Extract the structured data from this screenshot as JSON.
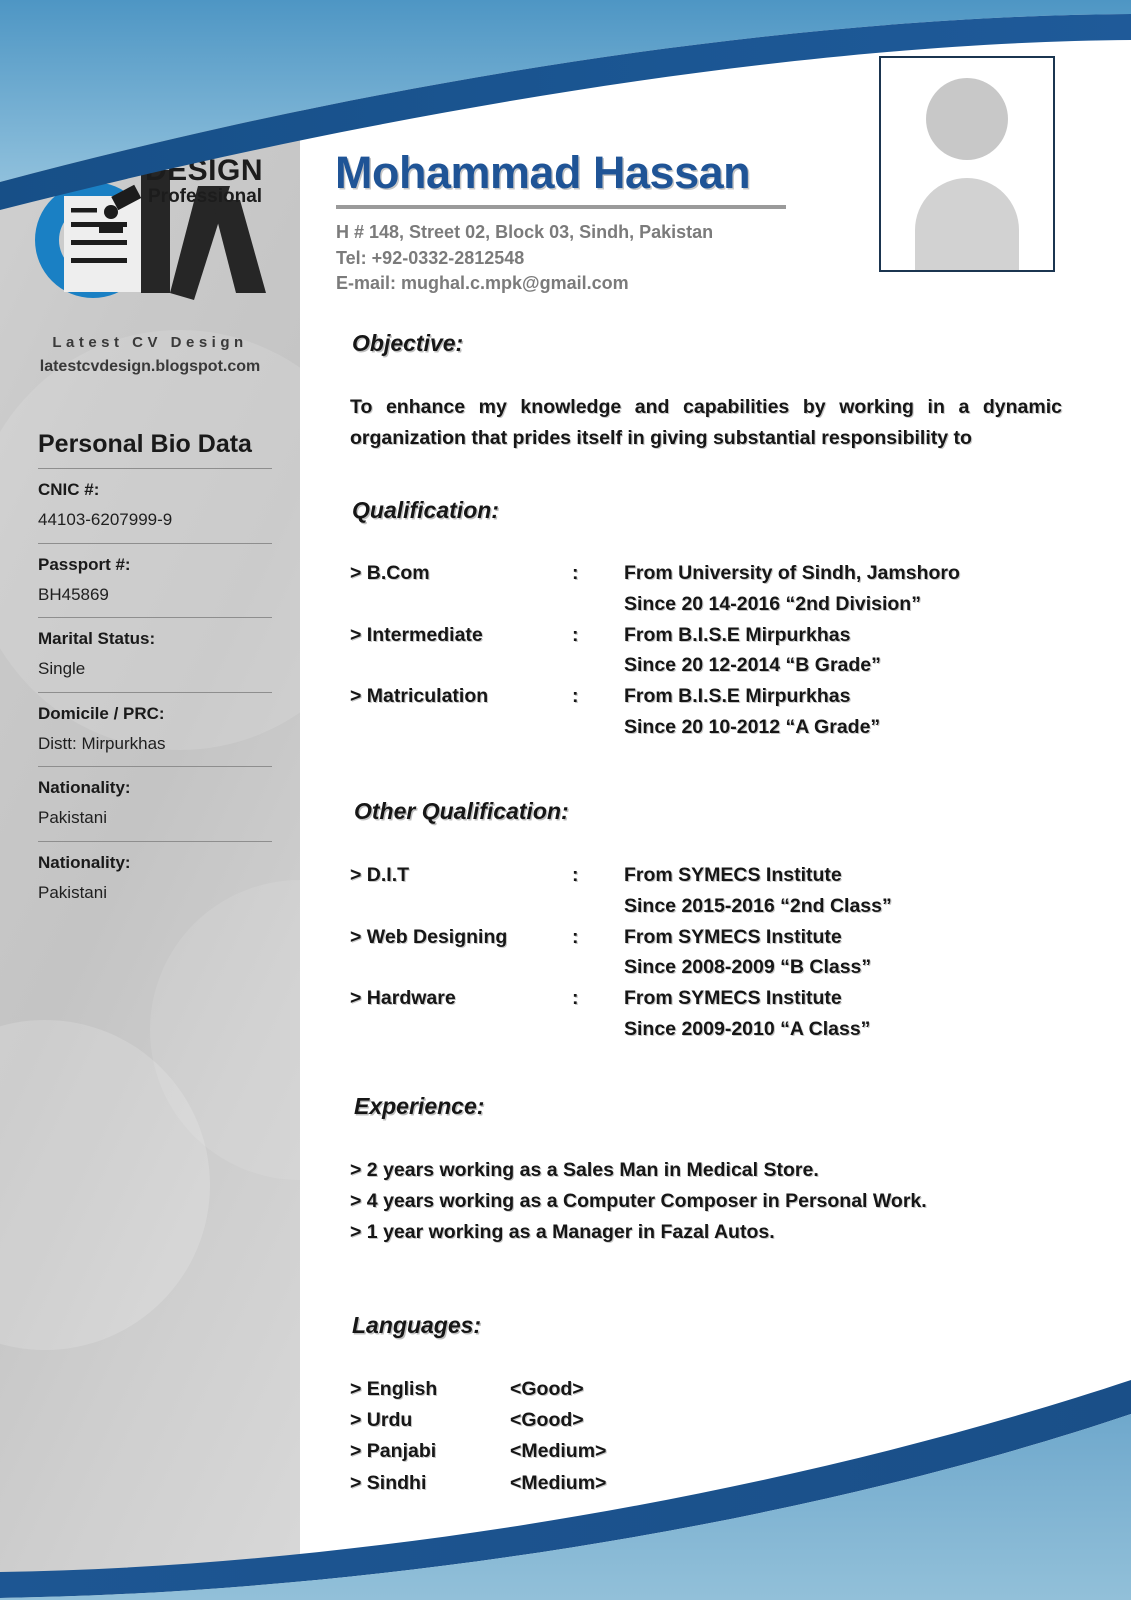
{
  "colors": {
    "accent_blue": "#1f5496",
    "swoosh_dark_blue": "#1b5693",
    "swoosh_light_blue": "#6fa8cc",
    "sidebar_gray": "#c9c9c9",
    "photo_border": "#1b3550",
    "contact_gray": "#7b7b7b"
  },
  "brand": {
    "logo_letters": "CV",
    "logo_design": "DESIGN",
    "logo_professional": "Professional",
    "tagline": "Latest CV Design",
    "url": "latestcvdesign.blogspot.com"
  },
  "header": {
    "name": "Mohammad Hassan",
    "address": "H # 148, Street 02, Block 03, Sindh, Pakistan",
    "phone": "Tel: +92-0332-2812548",
    "email": "E-mail: mughal.c.mpk@gmail.com"
  },
  "photo": {
    "alt": "applicant photo placeholder"
  },
  "sidebar": {
    "title": "Personal Bio Data",
    "fields": [
      {
        "label": "CNIC #:",
        "value": "44103-6207999-9"
      },
      {
        "label": "Passport #:",
        "value": "BH45869"
      },
      {
        "label": "Marital Status:",
        "value": "Single"
      },
      {
        "label": "Domicile / PRC:",
        "value": "Distt: Mirpurkhas"
      },
      {
        "label": "Nationality:",
        "value": "Pakistani"
      },
      {
        "label": "Nationality:",
        "value": "Pakistani"
      }
    ]
  },
  "sections": {
    "objective": {
      "heading": "Objective:",
      "body": "To enhance my knowledge and capabilities by working in a dynamic organization that prides itself in giving substantial responsibility to"
    },
    "qualification": {
      "heading": "Qualification:",
      "rows": [
        {
          "term": "> B.Com",
          "colon": ":",
          "line1": "From University of Sindh, Jamshoro",
          "line2": "Since 20 14-2016 “2nd Division”"
        },
        {
          "term": "> Intermediate",
          "colon": ":",
          "line1": "From B.I.S.E Mirpurkhas",
          "line2": "Since 20 12-2014 “B Grade”"
        },
        {
          "term": "> Matriculation",
          "colon": ":",
          "line1": "From B.I.S.E Mirpurkhas",
          "line2": "Since 20 10-2012 “A Grade”"
        }
      ]
    },
    "other_qualification": {
      "heading": "Other Qualification:",
      "rows": [
        {
          "term": "> D.I.T",
          "colon": ":",
          "line1": "From SYMECS Institute",
          "line2": "Since 2015-2016 “2nd Class”"
        },
        {
          "term": "> Web Designing",
          "colon": ":",
          "line1": "From SYMECS Institute",
          "line2": "Since 2008-2009 “B Class”"
        },
        {
          "term": "> Hardware",
          "colon": ":",
          "line1": "From SYMECS Institute",
          "line2": "Since 2009-2010 “A Class”"
        }
      ]
    },
    "experience": {
      "heading": "Experience:",
      "items": [
        "> 2 years working as a Sales Man in Medical Store.",
        "> 4 years working as a Computer Composer in Personal Work.",
        "> 1 year working as a Manager in Fazal Autos."
      ]
    },
    "languages": {
      "heading": "Languages:",
      "rows": [
        {
          "name": "> English",
          "level": "<Good>"
        },
        {
          "name": "> Urdu",
          "level": "<Good>"
        },
        {
          "name": "> Panjabi",
          "level": "<Medium>"
        },
        {
          "name": "> Sindhi",
          "level": "<Medium>"
        }
      ]
    }
  }
}
